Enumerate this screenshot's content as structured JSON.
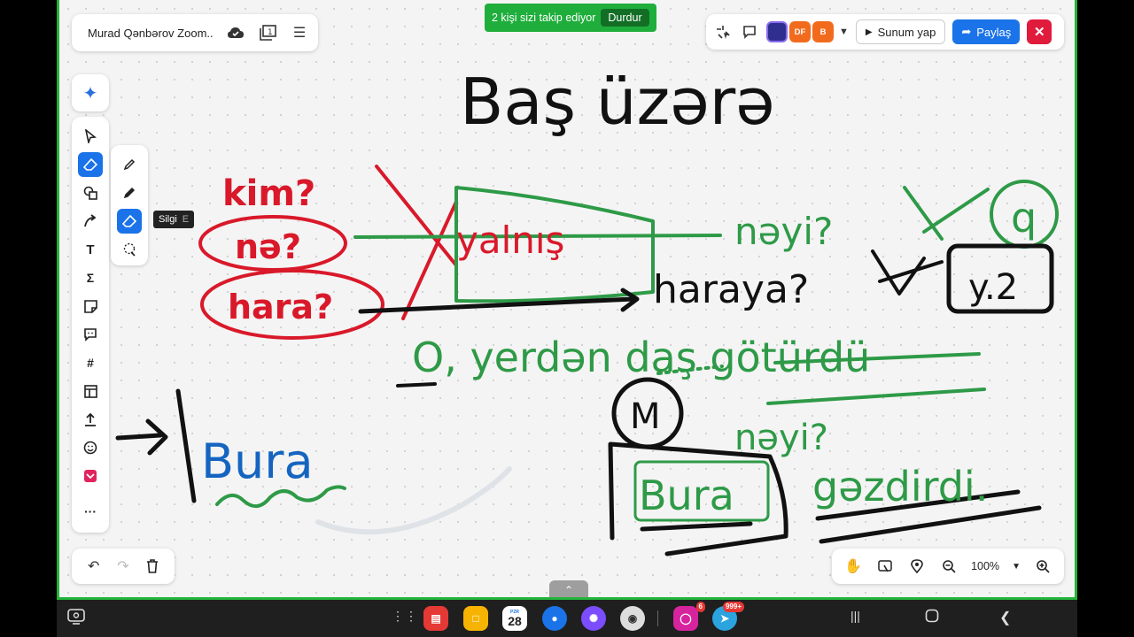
{
  "board": {
    "title": "Murad Qənbərov Zoom..."
  },
  "follow_banner": {
    "text": "2 kişi sizi takip ediyor",
    "stop_label": "Durdur"
  },
  "top_right": {
    "avatars": [
      {
        "label": "",
        "color": "#2f2f8f"
      },
      {
        "label": "DF",
        "color": "#f26b1d"
      },
      {
        "label": "B",
        "color": "#f26b1d"
      }
    ],
    "present_label": "Sunum yap",
    "share_label": "Paylaş"
  },
  "toolbar": {
    "tools": [
      "select-tool",
      "eraser-tool",
      "shapes-tool",
      "connector-tool",
      "text-tool",
      "formula-tool",
      "sticky-note-tool",
      "comment-tool",
      "frame-tool",
      "template-tool",
      "upload-tool",
      "emoji-tool",
      "app-tool",
      "more-tool"
    ],
    "active": "eraser-tool"
  },
  "subtools": {
    "tools": [
      "pen-tool",
      "marker-tool",
      "eraser-subtool",
      "lasso-eraser-tool"
    ],
    "active": "eraser-subtool"
  },
  "tooltip": {
    "label": "Silgi",
    "shortcut": "E"
  },
  "zoom": {
    "level": "100%"
  },
  "canvas_text": {
    "title": "Baş üzərə",
    "kim": "kim?",
    "ne": "nə?",
    "hara": "hara?",
    "yalnis": "yalnış",
    "neyi1": "nəyi?",
    "haraya": "haraya?",
    "circle_q": "q",
    "box_y2": "y.2",
    "sentence": "O, yerdən daş götürdü",
    "m_label": "M",
    "neyi2": "nəyi?",
    "bura_box": "Bura",
    "gezdirdi": "gəzdirdi.",
    "bura_blue": "Bura"
  },
  "taskbar": {
    "calendar_day": "28",
    "calendar_weekday": "PZR",
    "instagram_badge": "6",
    "telegram_badge": "999+"
  },
  "colors": {
    "accent": "#1a73e8",
    "banner": "#1fae3c",
    "ink_red": "#d9192a",
    "ink_green": "#2e9a47",
    "ink_black": "#111111",
    "ink_blue": "#1565c0",
    "frame_border": "#22b33a"
  }
}
